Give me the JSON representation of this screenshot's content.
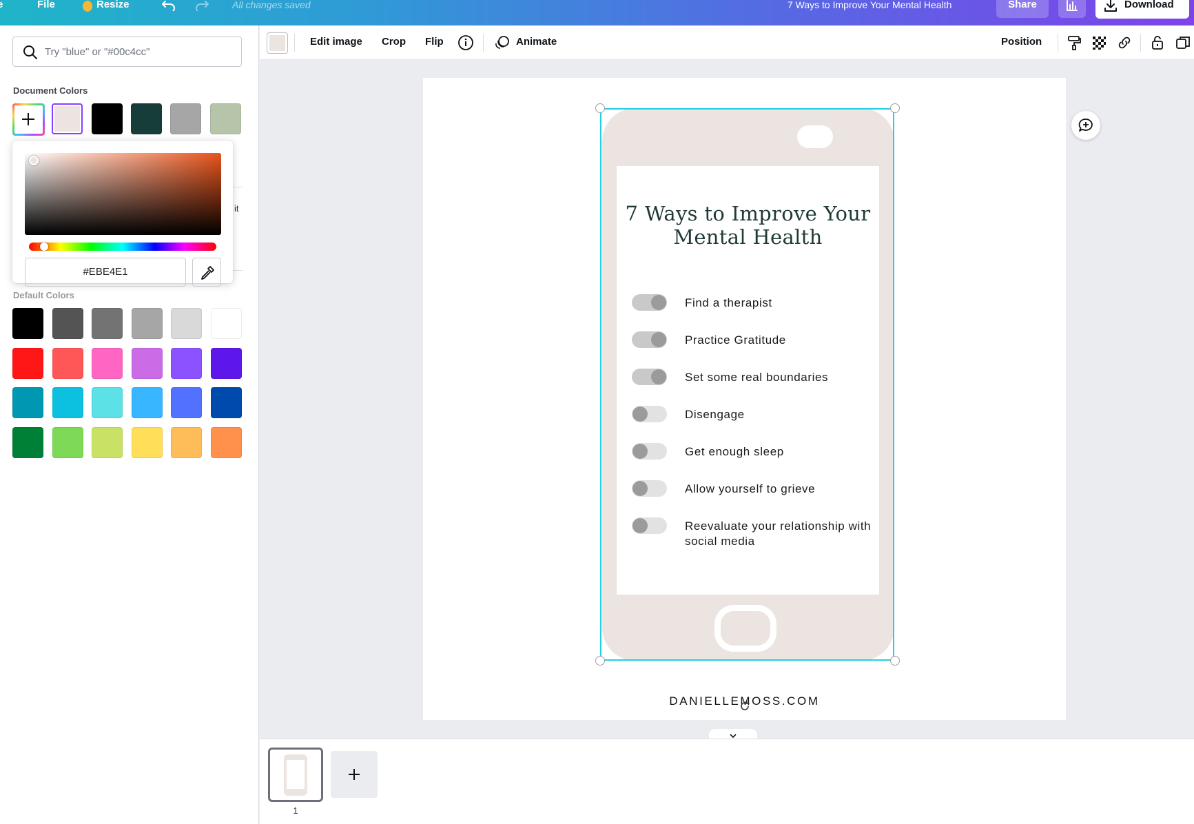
{
  "topbar": {
    "home_label": "e",
    "file_label": "File",
    "resize_label": "Resize",
    "status": "All changes saved",
    "document_title": "7 Ways to Improve Your Mental Health",
    "share_label": "Share",
    "download_label": "Download",
    "gradient_colors": [
      "#1fb5c9",
      "#5669e3",
      "#7d43ea"
    ]
  },
  "color_panel": {
    "search_placeholder": "Try \"blue\" or \"#00c4cc\"",
    "document_colors_label": "Document Colors",
    "document_colors": [
      "#ebe4e1",
      "#000000",
      "#173d3a",
      "#a6a6a6",
      "#b6c4a9"
    ],
    "selected_color": "#ebe4e1",
    "hidden_fragment": "it",
    "picker": {
      "hex_value": "#EBE4E1",
      "hue_color": "#e8531a"
    },
    "default_colors_label": "Default Colors",
    "default_colors": [
      [
        "#000000",
        "#545454",
        "#737373",
        "#a6a6a6",
        "#d9d9d9",
        "#ffffff"
      ],
      [
        "#ff1616",
        "#ff5757",
        "#ff66c4",
        "#cb6ce6",
        "#8c52ff",
        "#5e17eb"
      ],
      [
        "#0097b2",
        "#0cc0df",
        "#5ce1e6",
        "#38b6ff",
        "#5271ff",
        "#004aad"
      ],
      [
        "#008037",
        "#7ed957",
        "#c9e265",
        "#ffde59",
        "#ffbd59",
        "#ff914d"
      ]
    ]
  },
  "toolbar": {
    "chip_color": "#ebe4e1",
    "edit_image_label": "Edit image",
    "crop_label": "Crop",
    "flip_label": "Flip",
    "animate_label": "Animate",
    "position_label": "Position"
  },
  "design": {
    "title": "7 Ways to Improve Your Mental Health",
    "phone_color": "#ebe4e1",
    "selection_color": "#21d1e3",
    "tasks": [
      {
        "label": "Find a therapist",
        "checked": true
      },
      {
        "label": "Practice Gratitude",
        "checked": true
      },
      {
        "label": "Set some real boundaries",
        "checked": true
      },
      {
        "label": "Disengage",
        "checked": false
      },
      {
        "label": "Get enough sleep",
        "checked": false
      },
      {
        "label": "Allow yourself to grieve",
        "checked": false
      },
      {
        "label": "Reevaluate your relationship with social media",
        "checked": false
      }
    ],
    "website": "DANIELLEMOSS.COM"
  },
  "pages": {
    "current_page_number": "1"
  }
}
